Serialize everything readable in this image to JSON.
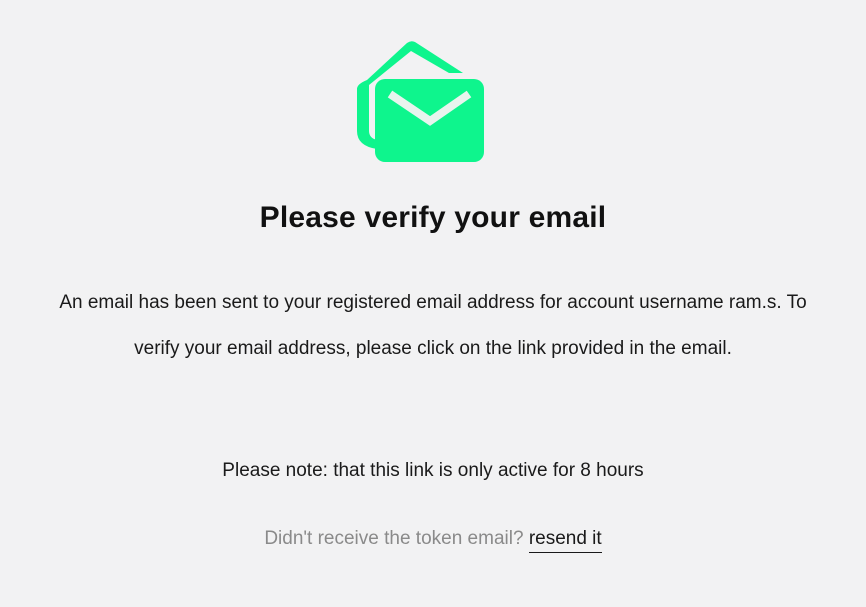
{
  "icon": {
    "name": "envelope-icon",
    "color": "#0ef58d"
  },
  "heading": "Please verify your email",
  "message": "An email has been sent to your registered email address for account username ram.s. To verify your email address, please click on the link provided in the email.",
  "note": "Please note: that this link is only active for 8 hours",
  "resend": {
    "prompt": "Didn't receive the token email?",
    "link_label": "resend it"
  }
}
